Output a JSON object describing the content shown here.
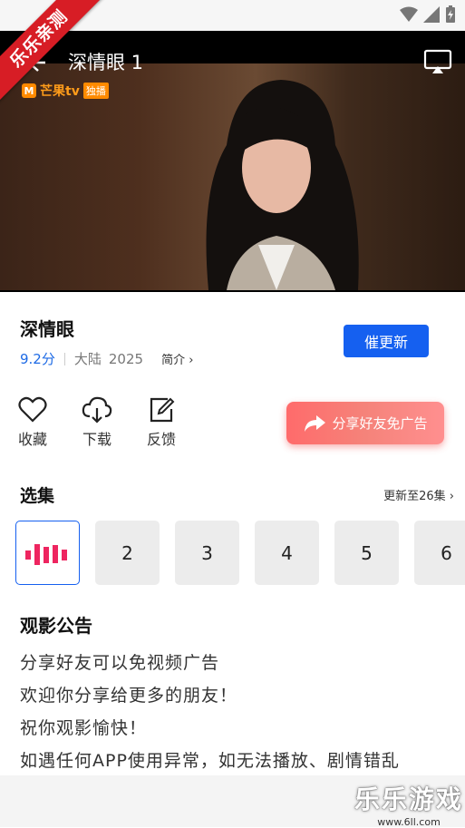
{
  "ribbon": "乐乐亲测",
  "player": {
    "title": "深情眼 1",
    "logo_text": "芒果tv",
    "logo_badge": "独播"
  },
  "info": {
    "title": "深情眼",
    "score": "9.2分",
    "region": "大陆",
    "year": "2025",
    "intro": "简介",
    "urge_label": "催更新"
  },
  "actions": [
    {
      "label": "收藏"
    },
    {
      "label": "下载"
    },
    {
      "label": "反馈"
    }
  ],
  "share_label": "分享好友免广告",
  "episodes_section": {
    "title": "选集",
    "update_text": "更新至26集"
  },
  "episodes": [
    "2",
    "3",
    "4",
    "5",
    "6"
  ],
  "notice": {
    "title": "观影公告",
    "lines": [
      "分享好友可以免视频广告",
      "欢迎你分享给更多的朋友！",
      "祝你观影愉快！",
      "如遇任何APP使用异常，如无法播放、剧情错乱"
    ]
  },
  "watermark": {
    "brand": "乐乐游戏",
    "url": "www.6ll.com"
  }
}
